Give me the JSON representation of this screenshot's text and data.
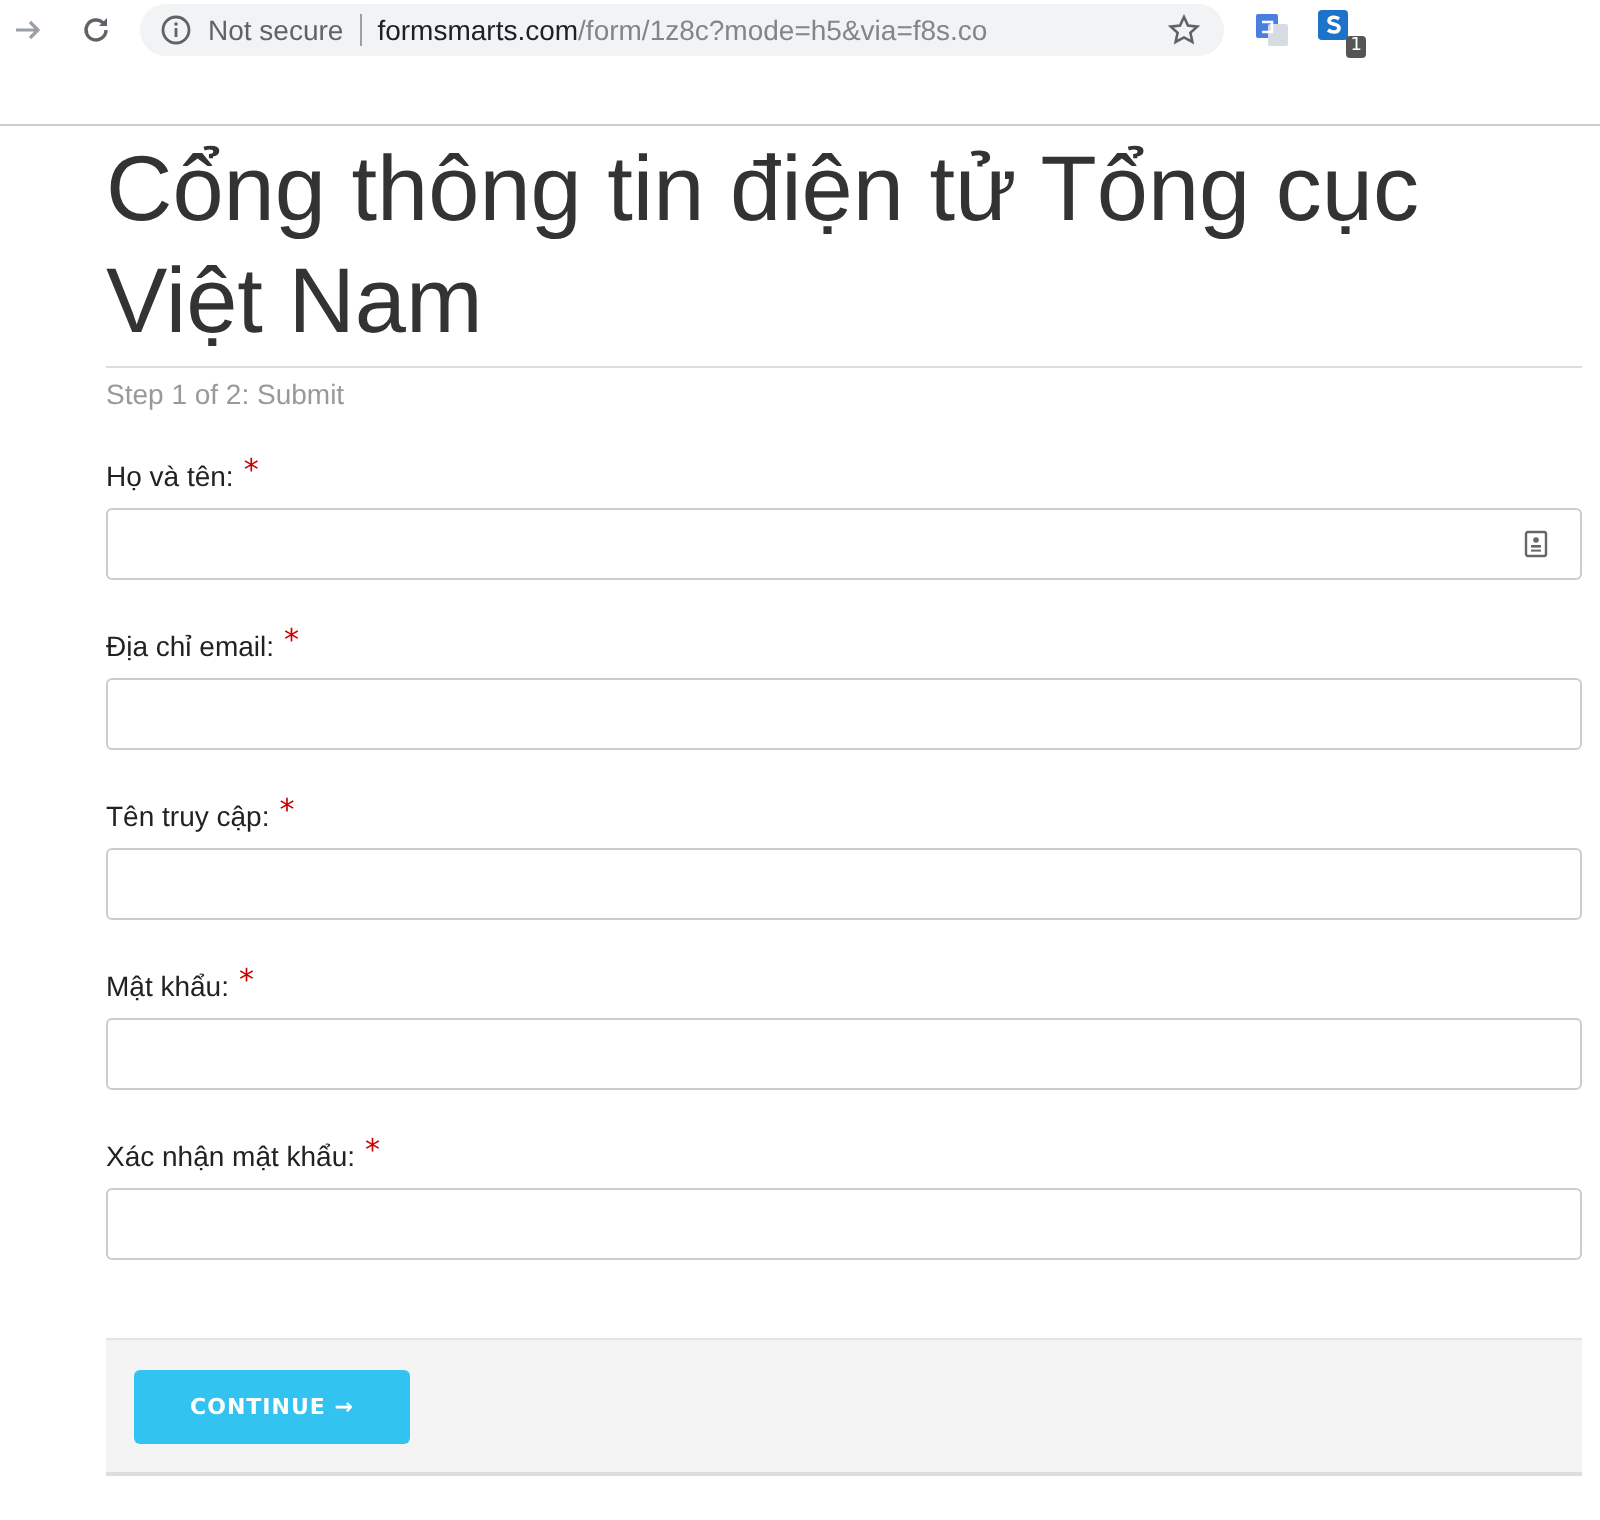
{
  "browser": {
    "security": "Not secure",
    "url_host": "formsmarts.com",
    "url_path": "/form/1z8c?mode=h5&via=f8s.co",
    "extension_badge": "1"
  },
  "form": {
    "title": "Cổng thông tin điện tử Tổng cục Việt Nam",
    "step": "Step 1 of 2: Submit",
    "fields": [
      {
        "label": "Họ và tên:",
        "required": "*",
        "autofill_icon": true
      },
      {
        "label": "Địa chỉ email:",
        "required": "*",
        "autofill_icon": false
      },
      {
        "label": "Tên truy cập:",
        "required": "*",
        "autofill_icon": false
      },
      {
        "label": "Mật khẩu:",
        "required": "*",
        "autofill_icon": false
      },
      {
        "label": "Xác nhận mật khẩu:",
        "required": "*",
        "autofill_icon": false
      }
    ],
    "button": "CONTINUE →"
  }
}
